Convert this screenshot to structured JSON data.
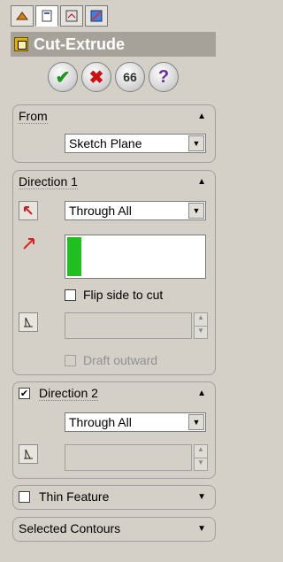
{
  "window": {
    "title": "Cut-Extrude"
  },
  "tabs": [
    {
      "name": "featuremanager-tab-icon"
    },
    {
      "name": "propertymanager-tab-icon"
    },
    {
      "name": "configurationmanager-tab-icon"
    },
    {
      "name": "dimxpert-tab-icon"
    }
  ],
  "actions": {
    "ok_icon": "✔",
    "cancel_icon": "✖",
    "preview_icon": "66",
    "help_icon": "?"
  },
  "from": {
    "title": "From",
    "selected": "Sketch Plane"
  },
  "direction1": {
    "title": "Direction 1",
    "end_condition": "Through All",
    "flip_label": "Flip side to cut",
    "draft_label": "Draft outward",
    "flip_checked": false
  },
  "direction2": {
    "title": "Direction 2",
    "checked": true,
    "end_condition": "Through All"
  },
  "thin_feature": {
    "title": "Thin Feature",
    "checked": false
  },
  "selected_contours": {
    "title": "Selected Contours"
  },
  "colors": {
    "selection_green": "#1fbf1f",
    "title_bar": "#a6a29a",
    "direction_arrow": "#e02020"
  }
}
